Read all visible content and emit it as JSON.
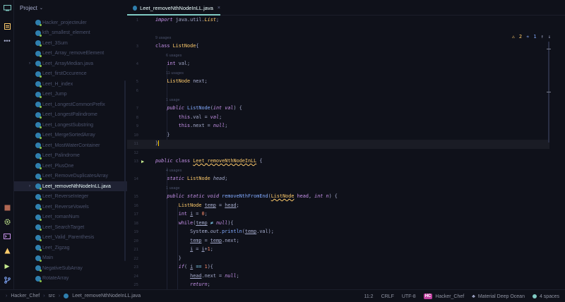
{
  "project": {
    "title": "Project"
  },
  "tree": {
    "items": [
      {
        "label": "Hacker_projecteuler",
        "arrow": false,
        "selected": false
      },
      {
        "label": "kth_smallest_element",
        "arrow": false,
        "selected": false
      },
      {
        "label": "Leet_3Sum",
        "arrow": false,
        "selected": false
      },
      {
        "label": "Leet_Array_removeElement",
        "arrow": false,
        "selected": false
      },
      {
        "label": "Leet_ArrayMedian.java",
        "arrow": true,
        "selected": false
      },
      {
        "label": "Leet_firstOccurence",
        "arrow": false,
        "selected": false
      },
      {
        "label": "Leet_H_index",
        "arrow": false,
        "selected": false
      },
      {
        "label": "Leet_Jump",
        "arrow": false,
        "selected": false
      },
      {
        "label": "Leet_LongestCommonPrefix",
        "arrow": false,
        "selected": false
      },
      {
        "label": "Leet_LongestPalindrome",
        "arrow": false,
        "selected": false
      },
      {
        "label": "Leet_LongestSubstring",
        "arrow": false,
        "selected": false
      },
      {
        "label": "Leet_MergeSortedArray",
        "arrow": false,
        "selected": false
      },
      {
        "label": "Leet_MostWaterContainer",
        "arrow": false,
        "selected": false
      },
      {
        "label": "Leet_Palindrome",
        "arrow": false,
        "selected": false
      },
      {
        "label": "Leet_PlusOne",
        "arrow": false,
        "selected": false
      },
      {
        "label": "Leet_RemoveDuplicatesArray",
        "arrow": false,
        "selected": false
      },
      {
        "label": "Leet_removeNthNodeInLL.java",
        "arrow": true,
        "selected": true
      },
      {
        "label": "Leet_ReverseInteger",
        "arrow": false,
        "selected": false
      },
      {
        "label": "Leet_ReverseVowels",
        "arrow": false,
        "selected": false
      },
      {
        "label": "Leet_romanNum",
        "arrow": false,
        "selected": false
      },
      {
        "label": "Leet_SearchTarget",
        "arrow": false,
        "selected": false
      },
      {
        "label": "Leet_Valid_Parenthesis",
        "arrow": false,
        "selected": false
      },
      {
        "label": "Leet_Zigzag",
        "arrow": false,
        "selected": false
      },
      {
        "label": "Main",
        "arrow": false,
        "selected": false
      },
      {
        "label": "NegativeSubArray",
        "arrow": false,
        "selected": false
      },
      {
        "label": "RotateArray",
        "arrow": false,
        "selected": false
      }
    ]
  },
  "tab": {
    "label": "Leet_removeNthNodeInLL.java",
    "close": "×"
  },
  "inspection": {
    "warnings": "2",
    "typos": "1"
  },
  "hints": {
    "h1": "9 usages",
    "h2": "6 usages",
    "h3": "11 usages",
    "h4": "1 usage",
    "h5": "4 usages",
    "h6": "1 usage"
  },
  "line_numbers": [
    "1",
    "2",
    "3",
    "4",
    "5",
    "6",
    "7",
    "8",
    "9",
    "10",
    "11",
    "12",
    "13",
    "14",
    "15",
    "16",
    "17",
    "18",
    "19",
    "20",
    "21",
    "22",
    "23",
    "24",
    "25"
  ],
  "statusbar": {
    "crumbs": [
      "Hacker_Chef",
      "src",
      "Leet_removeNthNodeInLL.java"
    ],
    "position": "11:2",
    "line_ending": "CRLF",
    "encoding": "UTF-8",
    "project_badge": "HC",
    "project_name": "Hacker_Chef",
    "theme": "Material Deep Ocean",
    "indent": "4 spaces"
  },
  "colors": {
    "background": "#0f111a",
    "accent": "#80cbc4",
    "keyword": "#c792ea",
    "type": "#ffcb6b",
    "function": "#82aaff",
    "number": "#f78c6c"
  }
}
